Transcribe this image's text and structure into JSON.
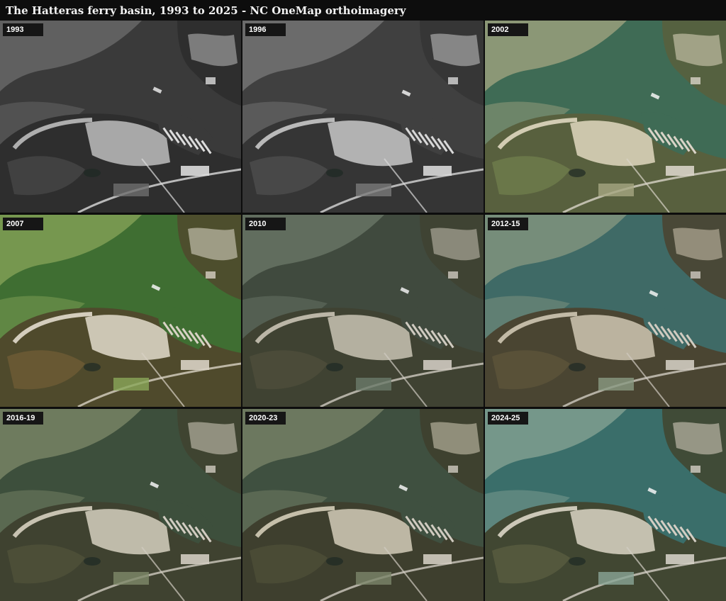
{
  "title": "The Hatteras ferry basin, 1993 to 2025  -  NC OneMap orthoimagery",
  "panels": [
    {
      "label": "1993",
      "palette": {
        "water": "#3a3a3a",
        "shallow": "#6e6e6e",
        "land": "#2e2e2e",
        "sand": "#bdbdbd",
        "marsh": "#444444",
        "dock": "#dcdcdc",
        "boat": "#e8e8e8"
      }
    },
    {
      "label": "1996",
      "palette": {
        "water": "#404040",
        "shallow": "#7a7a7a",
        "land": "#353535",
        "sand": "#c8c8c8",
        "marsh": "#4a4a4a",
        "dock": "#d8d8d8",
        "boat": "#f0f0f0"
      }
    },
    {
      "label": "2002",
      "palette": {
        "water": "#3f6b55",
        "shallow": "#a6a682",
        "land": "#58603e",
        "sand": "#e0d8c0",
        "marsh": "#6d7a4a",
        "dock": "#d9d4c8",
        "boat": "#f4f4f4"
      }
    },
    {
      "label": "2007",
      "palette": {
        "water": "#3f6e32",
        "shallow": "#8aa65a",
        "land": "#4f4a2c",
        "sand": "#e2dccd",
        "marsh": "#6a5a34",
        "dock": "#d8d2c4",
        "boat": "#f4f4f4"
      }
    },
    {
      "label": "2010",
      "palette": {
        "water": "#404a3e",
        "shallow": "#6c7a6a",
        "land": "#3f4232",
        "sand": "#c9c3b4",
        "marsh": "#4c4d3a",
        "dock": "#cfcac0",
        "boat": "#efefef"
      }
    },
    {
      "label": "2012-15",
      "palette": {
        "water": "#3f6a66",
        "shallow": "#8a9a82",
        "land": "#4a4532",
        "sand": "#cfc7b3",
        "marsh": "#5b5238",
        "dock": "#d0cbc0",
        "boat": "#f2f2f2"
      }
    },
    {
      "label": "2016-19",
      "palette": {
        "water": "#3d4f3c",
        "shallow": "#7f8a6a",
        "land": "#3f4230",
        "sand": "#d6d0c0",
        "marsh": "#4e5038",
        "dock": "#d1ccc1",
        "boat": "#f3f3f3"
      }
    },
    {
      "label": "2020-23",
      "palette": {
        "water": "#3f5040",
        "shallow": "#7c866a",
        "land": "#3e3f2e",
        "sand": "#d4cdb8",
        "marsh": "#4b4c36",
        "dock": "#d0cbc0",
        "boat": "#f3f3f3"
      }
    },
    {
      "label": "2024-25",
      "palette": {
        "water": "#3a6e6a",
        "shallow": "#8aa596",
        "land": "#414732",
        "sand": "#dcd6c6",
        "marsh": "#565a3e",
        "dock": "#d3cec4",
        "boat": "#f4f4f4"
      }
    }
  ]
}
